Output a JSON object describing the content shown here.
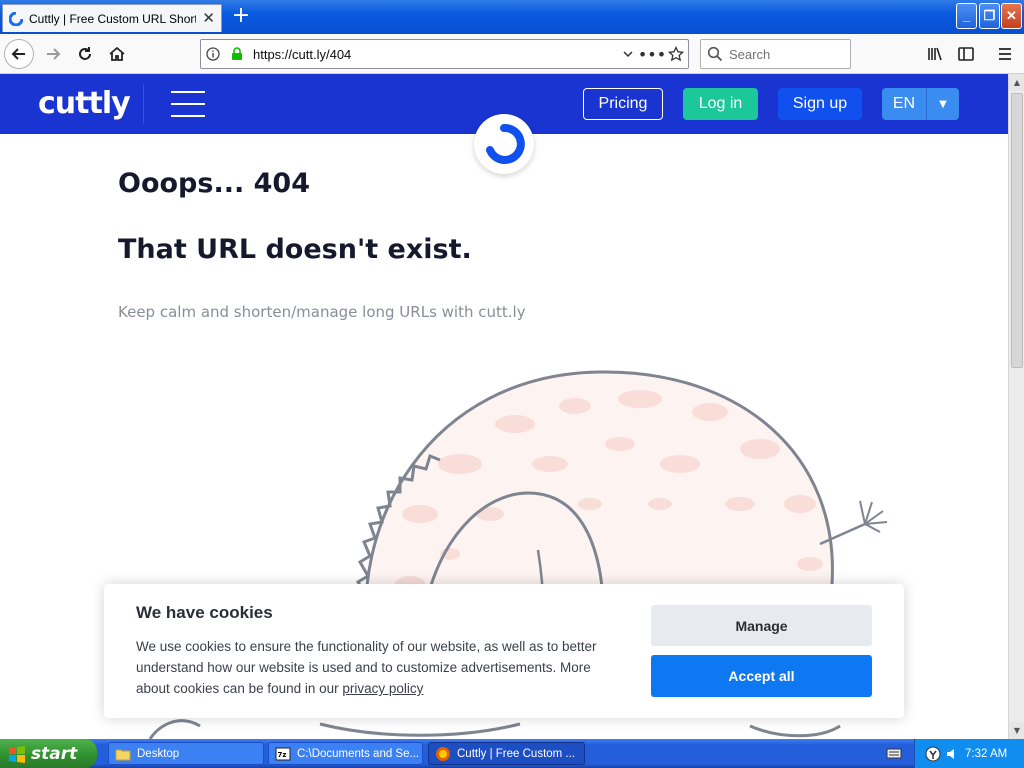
{
  "browser": {
    "tab_title": "Cuttly | Free Custom URL Shortener",
    "url": "https://cutt.ly/404",
    "search_placeholder": "Search"
  },
  "site": {
    "logo": "cuttly",
    "nav": {
      "pricing": "Pricing",
      "login": "Log in",
      "signup": "Sign up",
      "language": "EN"
    },
    "heading_404": "Ooops... 404",
    "heading_missing": "That URL doesn't exist.",
    "subtext": "Keep calm and shorten/manage long URLs with cutt.ly"
  },
  "cookie": {
    "title": "We have cookies",
    "body": "We use cookies to ensure the functionality of our website, as well as to better understand how our website is used and to customize advertisements. More about cookies can be found in our ",
    "link": "privacy policy",
    "manage": "Manage",
    "accept": "Accept all"
  },
  "taskbar": {
    "start": "start",
    "tasks": [
      {
        "label": "Desktop"
      },
      {
        "label": "C:\\Documents and Se..."
      },
      {
        "label": "Cuttly | Free Custom ..."
      }
    ],
    "clock": "7:32 AM"
  },
  "colors": {
    "brand_blue": "#1a34d1",
    "login_green": "#1cc89a",
    "accept_blue": "#0d78f2"
  },
  "icons": [
    "cuttly-favicon",
    "back-icon",
    "forward-icon",
    "reload-icon",
    "home-icon",
    "info-icon",
    "lock-icon",
    "dropdown-icon",
    "more-icon",
    "star-icon",
    "search-icon",
    "library-icon",
    "sidebar-icon",
    "menu-icon",
    "hamburger-icon",
    "chevron-down-icon",
    "windows-flag-icon",
    "folder-icon"
  ]
}
